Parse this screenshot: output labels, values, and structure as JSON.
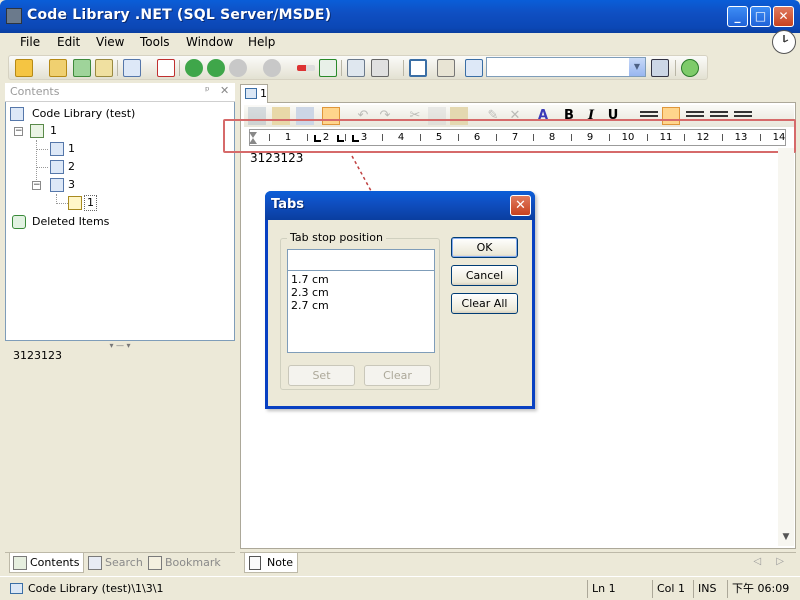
{
  "window": {
    "title": "Code Library .NET (SQL Server/MSDE)",
    "min": "_",
    "max": "□",
    "close": "✕"
  },
  "menu": [
    "File",
    "Edit",
    "View",
    "Tools",
    "Window",
    "Help"
  ],
  "left_pane": {
    "header": "Contents",
    "pin": "ᵖ",
    "close": "✕",
    "tree": {
      "root": "Code Library (test)",
      "node_1": "1",
      "child_1": "1",
      "child_2": "2",
      "child_3": "3",
      "grandchild_1": "1",
      "deleted": "Deleted Items"
    },
    "splitter": "▾ — ▾",
    "preview_text": "3123123",
    "tabs": [
      "Contents",
      "Search",
      "Bookmark"
    ]
  },
  "document": {
    "tab_label": "1",
    "text": "3123123",
    "ruler_numbers": [
      "1",
      "2",
      "3",
      "4",
      "5",
      "6",
      "7",
      "8",
      "9",
      "10",
      "11",
      "12",
      "13",
      "14"
    ],
    "format_buttons": {
      "bold": "B",
      "italic": "I",
      "underline": "U"
    }
  },
  "note_bar": {
    "tab": "Note",
    "arrows": "◁ ▷"
  },
  "dialog": {
    "title": "Tabs",
    "group_label": "Tab stop position",
    "input_value": "",
    "tab_stops": [
      "1.7 cm",
      "2.3 cm",
      "2.7 cm"
    ],
    "ok": "OK",
    "cancel": "Cancel",
    "clear_all": "Clear All",
    "set": "Set",
    "clear": "Clear"
  },
  "status": {
    "path": "Code Library (test)\\1\\3\\1",
    "line": "Ln 1",
    "col": "Col 1",
    "mode": "INS",
    "time": "下午 06:09"
  },
  "colors": {
    "title_blue": "#0a5ed8",
    "highlight_red": "#d66a6a",
    "face": "#ece9d8"
  }
}
